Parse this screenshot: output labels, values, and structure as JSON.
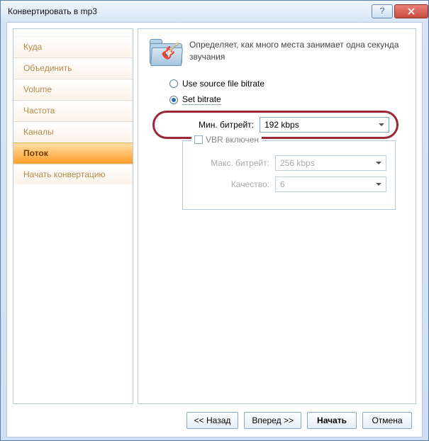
{
  "window": {
    "title": "Конвертировать в mp3"
  },
  "sidebar": {
    "items": [
      {
        "label": "Куда"
      },
      {
        "label": "Объединить"
      },
      {
        "label": "Volume"
      },
      {
        "label": "Частота"
      },
      {
        "label": "Каналы"
      },
      {
        "label": "Поток"
      },
      {
        "label": "Начать конвертацию"
      }
    ],
    "selectedIndex": 5
  },
  "main": {
    "description": "Определяет, как много места занимает одна секунда звучания",
    "radios": {
      "useSource": "Use source file bitrate",
      "setBitrate": "Set bitrate"
    },
    "minBitrate": {
      "label": "Мин. битрейт:",
      "value": "192 kbps"
    },
    "vbrGroup": {
      "checkboxLabel": "VBR включен",
      "maxBitrate": {
        "label": "Макс. битрейт:",
        "value": "256 kbps"
      },
      "quality": {
        "label": "Качество:",
        "value": "6"
      }
    }
  },
  "footer": {
    "back": "<< Назад",
    "forward": "Вперед >>",
    "start": "Начать",
    "cancel": "Отмена"
  }
}
